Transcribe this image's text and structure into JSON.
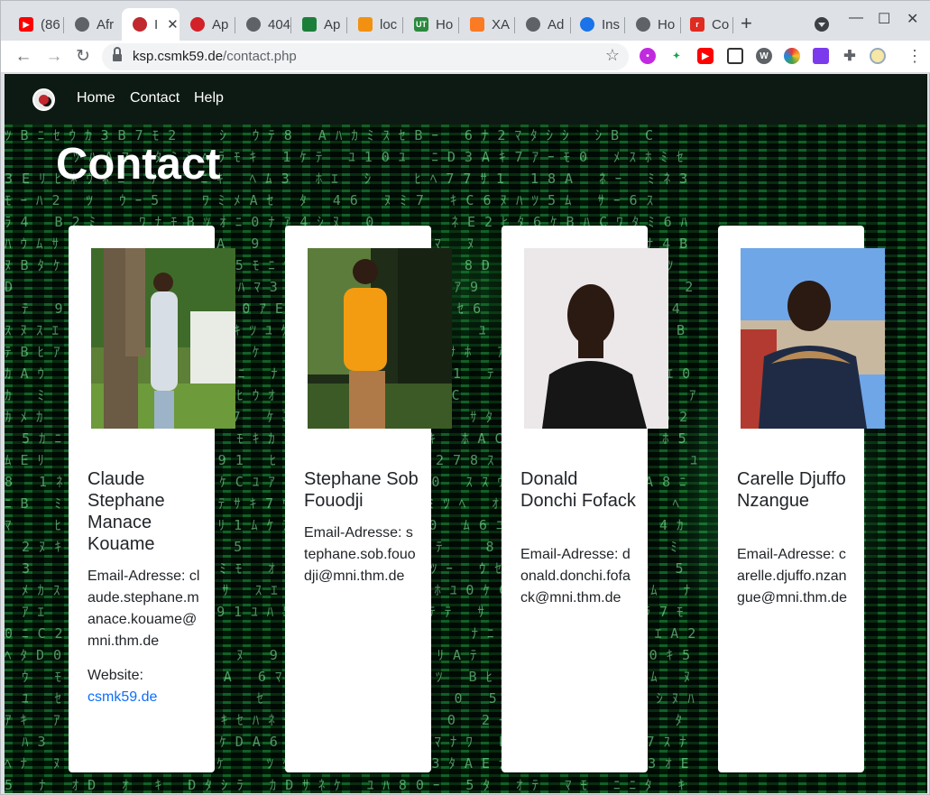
{
  "browser": {
    "tabs": [
      {
        "label": "(86",
        "icon": "youtube-icon",
        "color": "#ff0000"
      },
      {
        "label": "Afr",
        "icon": "globe-icon",
        "color": "#5f6368"
      },
      {
        "label": "I",
        "icon": "site-logo-icon",
        "color": "#c0282d",
        "active": true
      },
      {
        "label": "Ap",
        "icon": "apache-icon",
        "color": "#d22128"
      },
      {
        "label": "404",
        "icon": "globe-icon",
        "color": "#5f6368"
      },
      {
        "label": "Ap",
        "icon": "apache-icon",
        "color": "#1b7f3a"
      },
      {
        "label": "loc",
        "icon": "phpmyadmin-icon",
        "color": "#f29111"
      },
      {
        "label": "Ho",
        "icon": "ut-icon",
        "color": "#2b8a3e"
      },
      {
        "label": "XA",
        "icon": "xampp-icon",
        "color": "#fb7a24"
      },
      {
        "label": "Ad",
        "icon": "globe-icon",
        "color": "#5f6368"
      },
      {
        "label": "Ins",
        "icon": "cloud-icon",
        "color": "#1a73e8"
      },
      {
        "label": "Ho",
        "icon": "globe-icon",
        "color": "#5f6368"
      },
      {
        "label": "Co",
        "icon": "r-icon",
        "color": "#e02b20"
      }
    ],
    "url_domain": "ksp.csmk59.de",
    "url_path": "/contact.php"
  },
  "site": {
    "nav": [
      {
        "label": "Home"
      },
      {
        "label": "Contact"
      },
      {
        "label": "Help"
      }
    ],
    "title": "Contact"
  },
  "contacts": [
    {
      "name": "Claude Stephane Manace Kouame",
      "email_line": "Email-Adresse: claude.stephane.manace.kouame@mni.thm.de",
      "website_label": "Website:",
      "website": "csmk59.de"
    },
    {
      "name": "Stephane Sob Fouodji",
      "email_line": "Email-Adresse: stephane.sob.fouodji@mni.thm.de"
    },
    {
      "name": "Donald Donchi Fofack",
      "email_line": "Email-Adresse: donald.donchi.fofack@mni.thm.de"
    },
    {
      "name": "Carelle Djuffo Nzangue",
      "email_line": "Email-Adresse: carelle.djuffo.nzangue@mni.thm.de"
    }
  ],
  "colors": {
    "navbar_bg": "#0d1a13",
    "matrix_green": "#3cff78",
    "link": "#0d6efd"
  }
}
